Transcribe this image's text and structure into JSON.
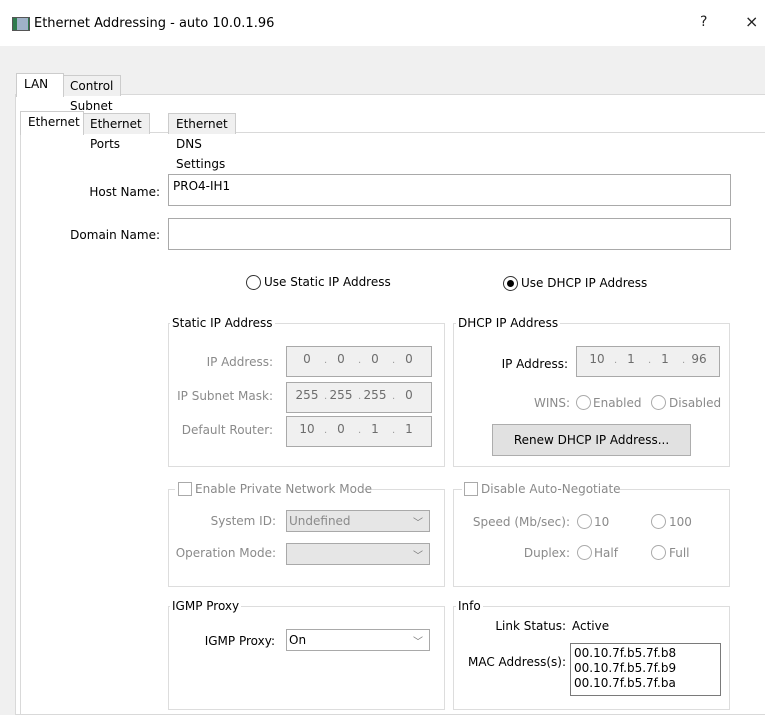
{
  "window": {
    "title": "Ethernet Addressing - auto 10.0.1.96",
    "help_glyph": "?",
    "close_glyph": "×"
  },
  "tabs": [
    "LAN",
    "Control Subnet"
  ],
  "subtabs": [
    "Ethernet",
    "Ethernet Ports",
    "Ethernet DNS Settings"
  ],
  "host": {
    "label": "Host Name:",
    "value": "PRO4-IH1"
  },
  "domain": {
    "label": "Domain Name:",
    "value": ""
  },
  "addressing": {
    "static_label": "Use Static IP Address",
    "dhcp_label": "Use DHCP IP Address",
    "selected": "dhcp"
  },
  "static": {
    "title": "Static IP Address",
    "ip_label": "IP Address:",
    "ip": [
      "0",
      "0",
      "0",
      "0"
    ],
    "mask_label": "IP Subnet Mask:",
    "mask": [
      "255",
      "255",
      "255",
      "0"
    ],
    "router_label": "Default Router:",
    "router": [
      "10",
      "0",
      "1",
      "1"
    ]
  },
  "dhcp": {
    "title": "DHCP IP Address",
    "ip_label": "IP Address:",
    "ip": [
      "10",
      "1",
      "1",
      "96"
    ],
    "wins_label": "WINS:",
    "wins_enabled": "Enabled",
    "wins_disabled": "Disabled",
    "renew_button": "Renew DHCP IP Address..."
  },
  "private": {
    "checkbox_label": "Enable Private Network Mode",
    "system_id_label": "System ID:",
    "system_id_value": "Undefined",
    "op_mode_label": "Operation Mode:",
    "op_mode_value": ""
  },
  "negotiate": {
    "checkbox_label": "Disable Auto-Negotiate",
    "speed_label": "Speed (Mb/sec):",
    "speed_10": "10",
    "speed_100": "100",
    "duplex_label": "Duplex:",
    "half": "Half",
    "full": "Full"
  },
  "igmp": {
    "title": "IGMP Proxy",
    "label": "IGMP Proxy:",
    "value": "On"
  },
  "info": {
    "title": "Info",
    "link_label": "Link Status:",
    "link_value": "Active",
    "mac_label": "MAC Address(s):",
    "macs": [
      "00.10.7f.b5.7f.b8",
      "00.10.7f.b5.7f.b9",
      "00.10.7f.b5.7f.ba"
    ]
  }
}
